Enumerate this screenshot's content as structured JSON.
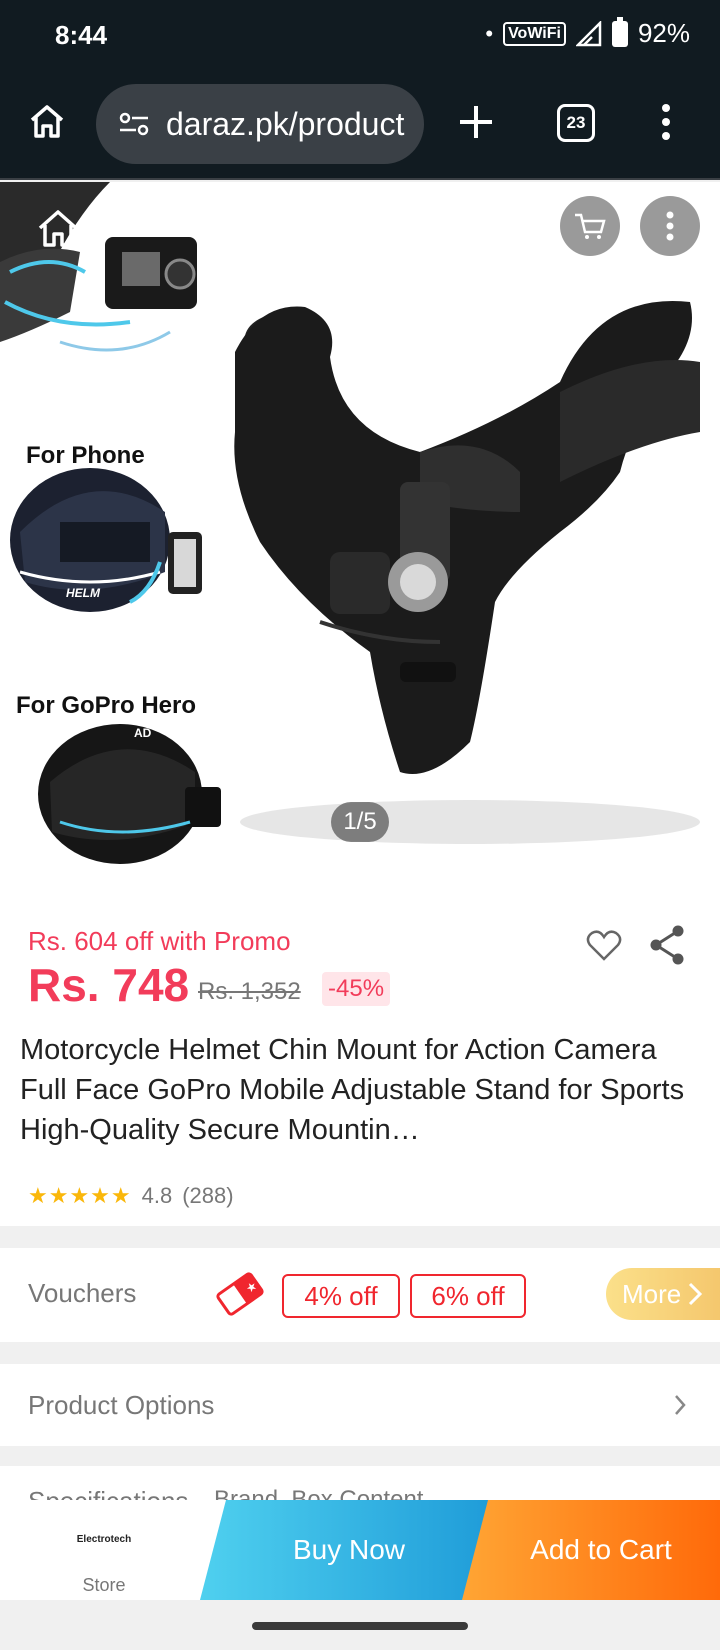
{
  "status_bar": {
    "time": "8:44",
    "dot": "•",
    "vowifi": "VoWiFi",
    "battery": "92%"
  },
  "browser": {
    "url": "daraz.pk/product",
    "tab_count": "23"
  },
  "gallery": {
    "label_phone": "For Phone",
    "label_gopro": "For GoPro Hero",
    "helmet_text_1": "HELM",
    "helmet_text_2": "AD",
    "pager": "1/5"
  },
  "price": {
    "promo": "Rs. 604 off with Promo",
    "current": "Rs. 748",
    "original": "Rs. 1,352",
    "discount": "-45%",
    "accent": "#f23c5a"
  },
  "product": {
    "title": "Motorcycle Helmet Chin Mount for Action Camera Full Face GoPro Mobile Adjustable Stand for Sports High-Quality Secure Mountin…",
    "stars": "★★★★★",
    "rating": "4.8",
    "reviews": "(288)",
    "rating_value": 4.8
  },
  "vouchers": {
    "label": "Vouchers",
    "chips": [
      "4% off",
      "6% off"
    ],
    "more": "More"
  },
  "options": {
    "label": "Product Options"
  },
  "spec_peek": {
    "label_1": "Specifications",
    "label_2": "Brand, Box Content"
  },
  "actions": {
    "store_name": "Electrotech",
    "store_label": "Store",
    "buy_now": "Buy Now",
    "add_to_cart": "Add to Cart"
  }
}
